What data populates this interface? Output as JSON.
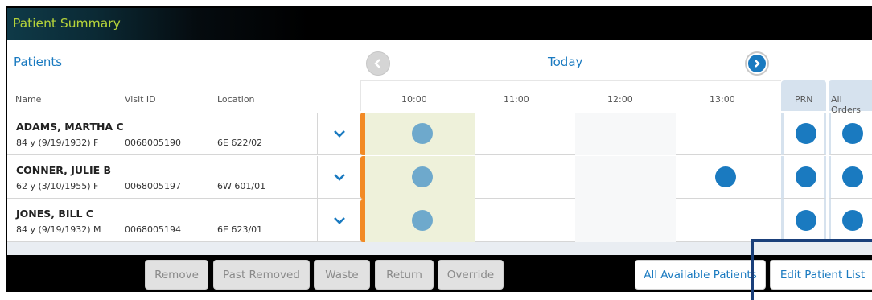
{
  "window": {
    "title": "Patient Summary"
  },
  "header": {
    "patients_label": "Patients",
    "today_label": "Today",
    "columns": {
      "name": "Name",
      "visit_id": "Visit ID",
      "location": "Location"
    },
    "times": [
      "10:00",
      "11:00",
      "12:00",
      "13:00"
    ],
    "prn_label": "PRN",
    "all_orders_label": "All Orders"
  },
  "patients": [
    {
      "name": "ADAMS, MARTHA C",
      "dob": "84 y (9/19/1932) F",
      "visit_id": "0068005190",
      "location": "6E 622/02"
    },
    {
      "name": "CONNER, JULIE B",
      "dob": "62 y (3/10/1955) F",
      "visit_id": "0068005197",
      "location": "6W 601/01"
    },
    {
      "name": "JONES, BILL C",
      "dob": "84 y (9/19/1932) M",
      "visit_id": "0068005194",
      "location": "6E 623/01"
    }
  ],
  "footer": {
    "remove": "Remove",
    "past_removed": "Past Removed",
    "waste": "Waste",
    "return": "Return",
    "override": "Override",
    "all_available_patients": "All Available Patients",
    "edit_patient_list": "Edit Patient List"
  },
  "colors": {
    "accent": "#1a7ac0",
    "title_text": "#b6d33a",
    "current_marker": "#f28a25"
  },
  "icons": {
    "prev": "chevron-left-icon",
    "next": "chevron-right-icon",
    "expand": "chevron-down-icon"
  }
}
